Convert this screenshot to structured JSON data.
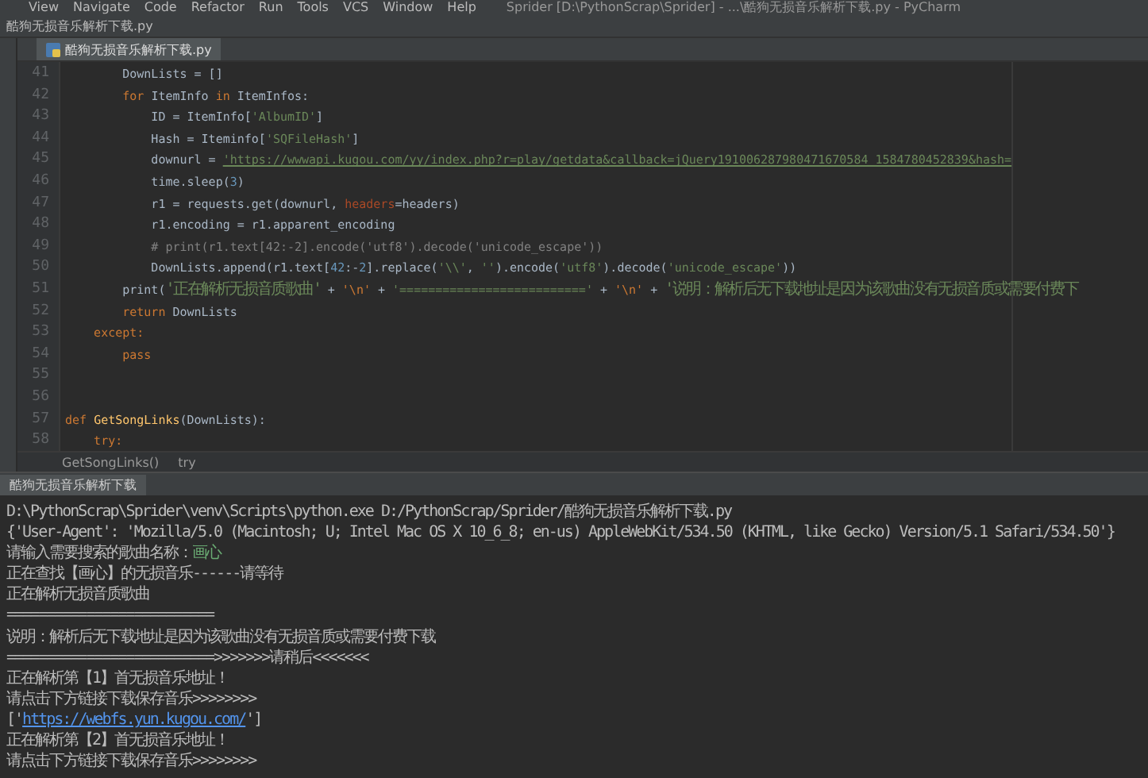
{
  "menu_bar": {
    "items": [
      "View",
      "Navigate",
      "Code",
      "Refactor",
      "Run",
      "Tools",
      "VCS",
      "Window",
      "Help"
    ],
    "title": "Sprider [D:\\PythonScrap\\Sprider] - ...\\酷狗无损音乐解析下载.py - PyCharm"
  },
  "file_path_tab": "酷狗无损音乐解析下载.py",
  "editor_tabs": [
    {
      "label": "酷狗无损音乐解析下载.py",
      "selected": true
    }
  ],
  "code_lines": [
    {
      "number": "41",
      "tokens": [
        {
          "text": "        DownLists",
          "kind": "var"
        },
        {
          "text": " = []",
          "kind": "plain"
        }
      ]
    },
    {
      "number": "42",
      "tokens": [
        {
          "text": "        for ",
          "kind": "kw"
        },
        {
          "text": "ItemInfo ",
          "kind": "var"
        },
        {
          "text": "in ",
          "kind": "kw"
        },
        {
          "text": "ItemInfos:",
          "kind": "plain"
        }
      ]
    },
    {
      "number": "43",
      "tokens": [
        {
          "text": "            ID",
          "kind": "var"
        },
        {
          "text": " = ItemInfo[",
          "kind": "plain"
        },
        {
          "text": "'AlbumID'",
          "kind": "str"
        },
        {
          "text": "]",
          "kind": "plain"
        }
      ]
    },
    {
      "number": "44",
      "tokens": [
        {
          "text": "            Hash",
          "kind": "var"
        },
        {
          "text": " = Iteminfo[",
          "kind": "plain"
        },
        {
          "text": "'SQFileHash'",
          "kind": "str"
        },
        {
          "text": "]",
          "kind": "plain"
        }
      ]
    },
    {
      "number": "45",
      "tokens": [
        {
          "text": "            downurl = ",
          "kind": "plain"
        },
        {
          "text": "'https://wwwapi.kugou.com/yy/index.php?r=play/getdata&callback=jQuery191006287980471670584_1584780452839&hash=",
          "kind": "url"
        }
      ]
    },
    {
      "number": "46",
      "tokens": [
        {
          "text": "            time.sleep(",
          "kind": "plain"
        },
        {
          "text": "3",
          "kind": "num"
        },
        {
          "text": ")",
          "kind": "plain"
        }
      ]
    },
    {
      "number": "47",
      "tokens": [
        {
          "text": "            r1 = requests.get(downurl, ",
          "kind": "plain"
        },
        {
          "text": "headers",
          "kind": "param"
        },
        {
          "text": "=headers)",
          "kind": "plain"
        }
      ]
    },
    {
      "number": "48",
      "tokens": [
        {
          "text": "            r1.encoding = r1.apparent_encoding",
          "kind": "plain"
        }
      ]
    },
    {
      "number": "49",
      "tokens": [
        {
          "text": "            # print(r1.text[42:-2].encode('utf8').decode('unicode_escape'))",
          "kind": "cmt"
        }
      ]
    },
    {
      "number": "50",
      "tokens": [
        {
          "text": "            DownLists.append(r1.text[",
          "kind": "plain"
        },
        {
          "text": "42",
          "kind": "num"
        },
        {
          "text": ":-",
          "kind": "plain"
        },
        {
          "text": "2",
          "kind": "num"
        },
        {
          "text": "].replace(",
          "kind": "plain"
        },
        {
          "text": "'\\\\'",
          "kind": "str"
        },
        {
          "text": ", ",
          "kind": "plain"
        },
        {
          "text": "''",
          "kind": "str"
        },
        {
          "text": ").encode(",
          "kind": "plain"
        },
        {
          "text": "'utf8'",
          "kind": "str"
        },
        {
          "text": ").decode(",
          "kind": "plain"
        },
        {
          "text": "'unicode_escape'",
          "kind": "str"
        },
        {
          "text": "))",
          "kind": "plain"
        }
      ]
    },
    {
      "number": "51",
      "tokens": [
        {
          "text": "        print(",
          "kind": "plain"
        },
        {
          "text": "'正在解析无损音质歌曲'",
          "kind": "str_cjk"
        },
        {
          "text": " + ",
          "kind": "plain"
        },
        {
          "text": "'\\n'",
          "kind": "esc"
        },
        {
          "text": " + ",
          "kind": "plain"
        },
        {
          "text": "'=========================='",
          "kind": "str"
        },
        {
          "text": " + ",
          "kind": "plain"
        },
        {
          "text": "'\\n'",
          "kind": "esc"
        },
        {
          "text": " + ",
          "kind": "plain"
        },
        {
          "text": "'说明：解析后无下载地址是因为该歌曲没有无损音质或需要付费下",
          "kind": "str_cjk"
        }
      ]
    },
    {
      "number": "52",
      "tokens": [
        {
          "text": "        return ",
          "kind": "kw"
        },
        {
          "text": "DownLists",
          "kind": "plain"
        }
      ]
    },
    {
      "number": "53",
      "tokens": [
        {
          "text": "    except:",
          "kind": "kw"
        }
      ]
    },
    {
      "number": "54",
      "tokens": [
        {
          "text": "        pass",
          "kind": "kw"
        }
      ]
    },
    {
      "number": "55"
    },
    {
      "number": "56"
    },
    {
      "number": "57",
      "tokens": [
        {
          "text": "def ",
          "kind": "kw"
        },
        {
          "text": "GetSongLinks",
          "kind": "fn"
        },
        {
          "text": "(DownLists):",
          "kind": "plain"
        }
      ]
    },
    {
      "number": "58",
      "tokens": [
        {
          "text": "    try:",
          "kind": "kw"
        }
      ]
    }
  ],
  "breadcrumb": [
    "GetSongLinks()",
    "try"
  ],
  "run_tab": "酷狗无损音乐解析下载",
  "console_lines": [
    [
      {
        "text": "D:\\PythonScrap\\Sprider\\venv\\Scripts\\python.exe D:/PythonScrap/Sprider/酷狗无损音乐解析下载.py",
        "kind": "plain"
      }
    ],
    [
      {
        "text": "{'User-Agent': 'Mozilla/5.0 (Macintosh; U; Intel Mac OS X 10_6_8; en-us) AppleWebKit/534.50 (KHTML, like Gecko) Version/5.1 Safari/534.50'}",
        "kind": "plain"
      }
    ],
    [
      {
        "text": "请输入需要搜索的歌曲名称：",
        "kind": "plain"
      },
      {
        "text": "画心",
        "kind": "input"
      }
    ],
    [
      {
        "text": "正在查找【画心】的无损音乐------请等待",
        "kind": "plain"
      }
    ],
    [
      {
        "text": "正在解析无损音质歌曲",
        "kind": "plain"
      }
    ],
    [
      {
        "text": "==========================",
        "kind": "plain"
      }
    ],
    [
      {
        "text": "说明：解析后无下载地址是因为该歌曲没有无损音质或需要付费下载",
        "kind": "plain"
      }
    ],
    [
      {
        "text": "==========================>>>>>>>请稍后<<<<<<<",
        "kind": "plain"
      }
    ],
    [
      {
        "text": "正在解析第【1】首无损音乐地址！",
        "kind": "plain"
      }
    ],
    [
      {
        "text": "请点击下方链接下载保存音乐>>>>>>>>",
        "kind": "plain"
      }
    ],
    [
      {
        "text": "['",
        "kind": "plain"
      },
      {
        "text": "https://webfs.yun.kugou.com/",
        "kind": "link"
      },
      {
        "text": "']",
        "kind": "plain"
      }
    ],
    [
      {
        "text": "正在解析第【2】首无损音乐地址！",
        "kind": "plain"
      }
    ],
    [
      {
        "text": "请点击下方链接下载保存音乐>>>>>>>>",
        "kind": "plain"
      }
    ]
  ]
}
